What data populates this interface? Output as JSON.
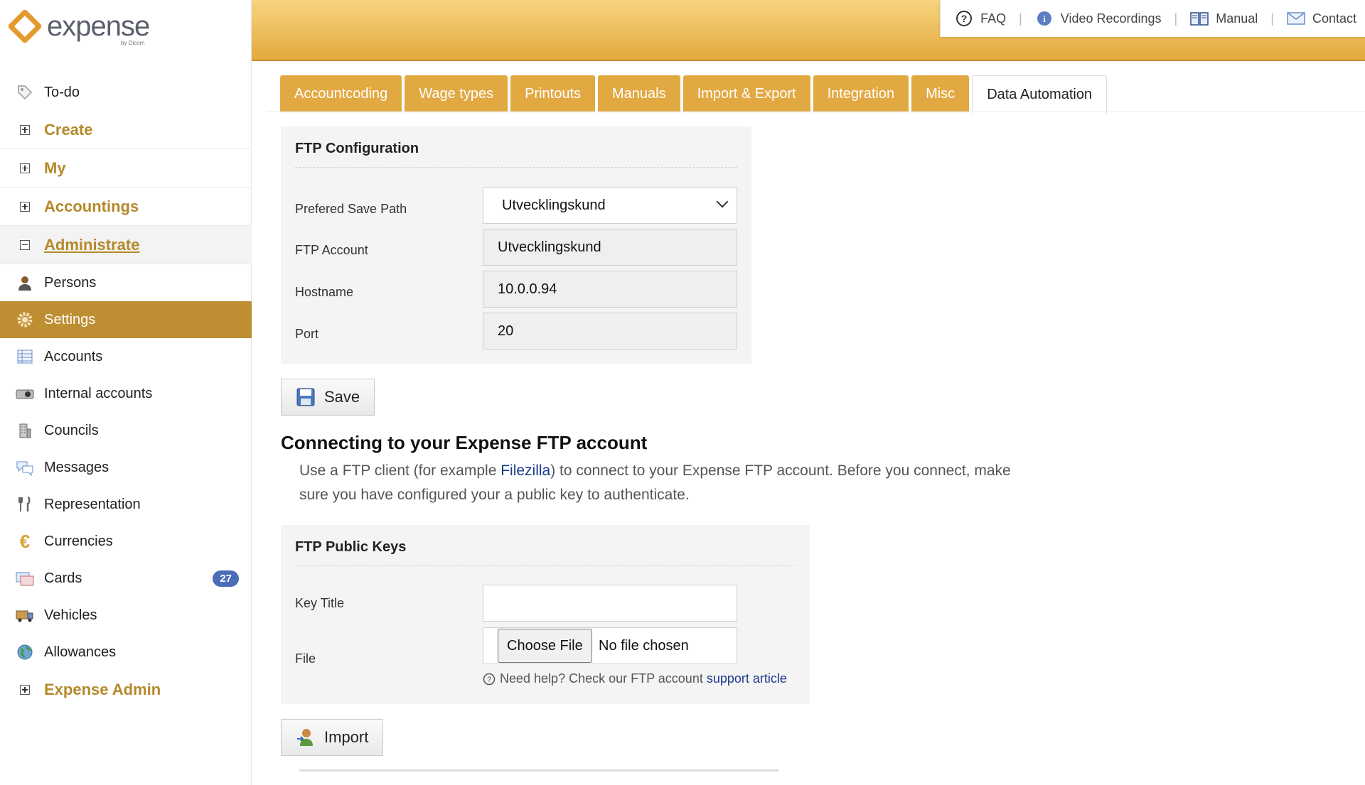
{
  "app": {
    "logo_text": "expense",
    "logo_sub": "by Dicom"
  },
  "colors": {
    "accent": "#be8e32",
    "header_gradient_top": "#f7d47f",
    "header_gradient_bottom": "#e3a93d",
    "tab": "#e2a842",
    "link": "#1a3a8c",
    "badge": "#4b6cb7"
  },
  "header_links": [
    {
      "label": "FAQ",
      "icon": "question-circle-icon"
    },
    {
      "label": "Video Recordings",
      "icon": "info-icon"
    },
    {
      "label": "Manual",
      "icon": "book-icon"
    },
    {
      "label": "Contact",
      "icon": "mail-icon"
    }
  ],
  "sidebar": {
    "todo": "To-do",
    "create": "Create",
    "my": "My",
    "accountings": "Accountings",
    "administrate": "Administrate",
    "persons": "Persons",
    "settings": "Settings",
    "accounts": "Accounts",
    "internal_accounts": "Internal accounts",
    "councils": "Councils",
    "messages": "Messages",
    "representation": "Representation",
    "currencies": "Currencies",
    "cards": "Cards",
    "cards_badge": "27",
    "vehicles": "Vehicles",
    "allowances": "Allowances",
    "expense_admin": "Expense Admin"
  },
  "tabs": [
    "Accountcoding",
    "Wage types",
    "Printouts",
    "Manuals",
    "Import & Export",
    "Integration",
    "Misc",
    "Data Automation"
  ],
  "active_tab": "Data Automation",
  "ftp_config": {
    "title": "FTP Configuration",
    "save_path_label": "Prefered Save Path",
    "save_path_value": "Utvecklingskund",
    "account_label": "FTP Account",
    "account_value": "Utvecklingskund",
    "hostname_label": "Hostname",
    "hostname_value": "10.0.0.94",
    "port_label": "Port",
    "port_value": "20",
    "save_button": "Save"
  },
  "connect": {
    "heading": "Connecting to your Expense FTP account",
    "text_before": "Use a FTP client (for example ",
    "link": "Filezilla",
    "text_after": ") to connect to your Expense FTP account. Before you connect, make sure you have configured your a public key to authenticate."
  },
  "public_keys": {
    "title": "FTP Public Keys",
    "key_title_label": "Key Title",
    "key_title_value": "",
    "file_label": "File",
    "choose_file": "Choose File",
    "no_file": "No file chosen",
    "help_text": "Need help? Check our FTP account",
    "help_link": "support article",
    "import_button": "Import"
  }
}
